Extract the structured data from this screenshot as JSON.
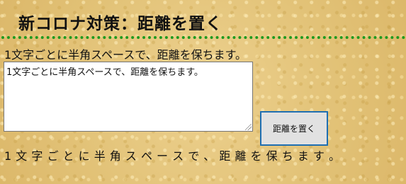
{
  "page": {
    "title": "新コロナ対策：距離を置く"
  },
  "instruction": {
    "text": "1文字ごとに半角スペースで、距離を保ちます。"
  },
  "input": {
    "value": "1文字ごとに半角スペースで、距離を保ちます。"
  },
  "button": {
    "label": "距離を置く"
  },
  "result": {
    "text": "1 文 字 ご と に 半 角 ス ペ ー ス で 、 距 離 を 保 ち ま す 。"
  },
  "colors": {
    "divider": "#1f9a1f",
    "button_border": "#1f6fb2",
    "background": "#e6c87f"
  }
}
